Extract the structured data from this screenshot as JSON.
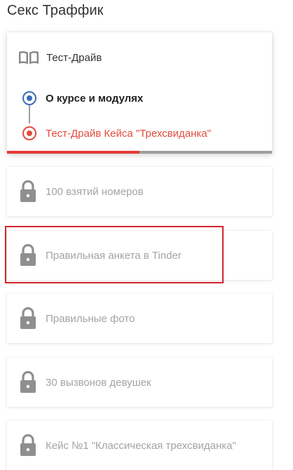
{
  "page": {
    "title": "Секс Траффик"
  },
  "current_module": {
    "icon": "book-icon",
    "title": "Тест-Драйв",
    "steps": [
      {
        "label": "О курсе и модулях",
        "status": "completed"
      },
      {
        "label": "Тест-Драйв Кейса \"Трехсвиданка\"",
        "status": "current"
      }
    ],
    "progress_fraction": 0.5
  },
  "locked_modules": [
    {
      "label": "100 взятий номеров",
      "icon": "lock-icon"
    },
    {
      "label": "Правильная анкета в Tinder",
      "icon": "lock-icon"
    },
    {
      "label": "Правильные фото",
      "icon": "lock-icon"
    },
    {
      "label": "30 вызвонов девушек",
      "icon": "lock-icon"
    },
    {
      "label": "Кейс №1 \"Классическая трехсвиданка\"",
      "icon": "lock-icon"
    }
  ],
  "colors": {
    "accent_red": "#e24c3f",
    "step_blue": "#3b6cb7",
    "highlight": "#d3252b",
    "locked_text": "#a3a3a3"
  }
}
